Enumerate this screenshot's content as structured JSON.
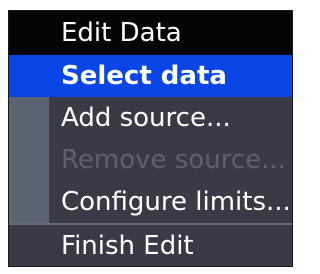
{
  "menu": {
    "title": "Edit Data",
    "items": [
      {
        "label": "Select data",
        "state": "selected"
      },
      {
        "label": "Add source...",
        "state": "enabled"
      },
      {
        "label": "Remove source...",
        "state": "disabled"
      },
      {
        "label": "Configure limits...",
        "state": "enabled"
      }
    ],
    "footer_item": {
      "label": "Finish Edit",
      "state": "enabled"
    },
    "colors": {
      "background": "#3a3a46",
      "title_bar": "#050505",
      "highlight": "#0a46e6",
      "side_strip": "#5b6472",
      "text": "#ffffff",
      "disabled_text": "#5e5f6b"
    }
  }
}
